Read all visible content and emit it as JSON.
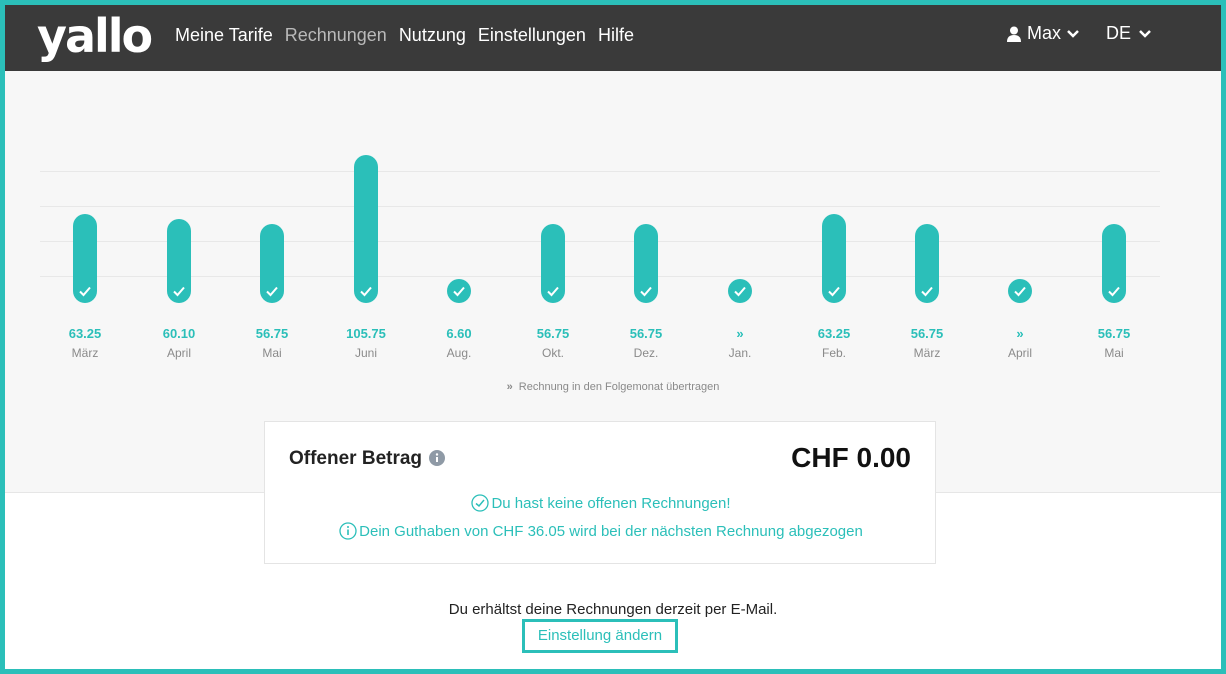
{
  "brand": {
    "logo_text": "yallo",
    "accent_color": "#2bbfb9",
    "navbar_color": "#3a3a3a"
  },
  "nav": {
    "items": [
      {
        "label": "Meine Tarife",
        "active": false
      },
      {
        "label": "Rechnungen",
        "active": true
      },
      {
        "label": "Nutzung",
        "active": false
      },
      {
        "label": "Einstellungen",
        "active": false
      },
      {
        "label": "Hilfe",
        "active": false
      }
    ],
    "user_label": "Max",
    "user_icon": "user-icon",
    "lang_label": "DE"
  },
  "chart_data": {
    "type": "bar",
    "categories": [
      "März",
      "April",
      "Mai",
      "Juni",
      "Aug.",
      "Okt.",
      "Dez.",
      "Jan.",
      "Feb.",
      "März",
      "April",
      "Mai"
    ],
    "values": [
      63.25,
      60.1,
      56.75,
      105.75,
      6.6,
      56.75,
      56.75,
      null,
      63.25,
      56.75,
      null,
      56.75
    ],
    "value_labels": [
      "63.25",
      "60.10",
      "56.75",
      "105.75",
      "6.60",
      "56.75",
      "56.75",
      "»",
      "63.25",
      "56.75",
      "»",
      "56.75"
    ],
    "paid": [
      true,
      true,
      true,
      true,
      true,
      true,
      true,
      true,
      true,
      true,
      true,
      true
    ],
    "carried_over": [
      false,
      false,
      false,
      false,
      false,
      false,
      false,
      true,
      false,
      false,
      true,
      false
    ],
    "grid": true,
    "legend_text": "Rechnung in den Folgemonat übertragen",
    "legend_symbol": "»"
  },
  "balance": {
    "title": "Offener Betrag",
    "amount": "CHF 0.00",
    "no_open_invoices": "Du hast keine offenen Rechnungen!",
    "credit_note": "Dein Guthaben von CHF 36.05 wird bei der nächsten Rechnung abgezogen"
  },
  "delivery": {
    "text": "Du erhältst deine Rechnungen derzeit per E-Mail.",
    "change_link": "Einstellung ändern"
  }
}
